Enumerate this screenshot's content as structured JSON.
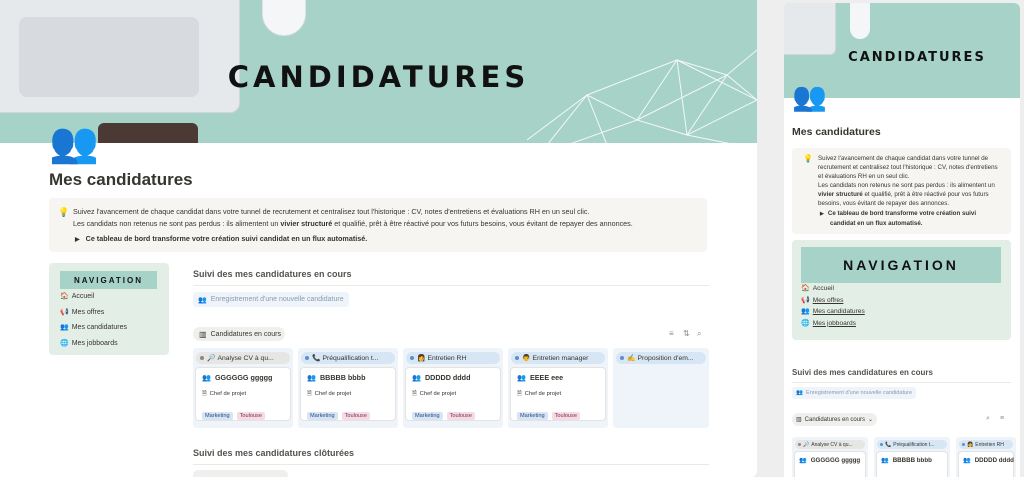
{
  "cover": {
    "title": "CANDIDATURES"
  },
  "page": {
    "icon": "people-icon",
    "title": "Mes candidatures"
  },
  "callout": {
    "icon": "lightbulb-icon",
    "line1": "Suivez l'avancement de chaque candidat dans votre tunnel de recrutement et centralisez tout l'historique : CV, notes d'entretiens et évaluations RH en un seul clic.",
    "line2_pre": "Les candidats non retenus ne sont pas perdus : ils alimentent un ",
    "line2_bold": "vivier structuré",
    "line2_post": " et qualifié, prêt à être réactivé pour vos futurs besoins, vous évitant de repayer des annonces.",
    "toggle": "Ce tableau de bord transforme votre création suivi candidat en un flux automatisé."
  },
  "navigation": {
    "title": "NAVIGATION",
    "items": [
      {
        "icon": "home-icon",
        "label": "Accueil"
      },
      {
        "icon": "megaphone-icon",
        "label": "Mes offres"
      },
      {
        "icon": "people-icon",
        "label": "Mes candidatures"
      },
      {
        "icon": "globe-icon",
        "label": "Mes jobboards"
      }
    ]
  },
  "open_section": {
    "title": "Suivi des mes candidatures en cours",
    "new_button": "Enregistrement d'une nouvelle candidature",
    "view_tab": "Candidatures en cours",
    "columns": [
      {
        "status": "Analyse CV à qu...",
        "status_icon": "magnifier-icon",
        "gray": true,
        "card": {
          "name": "GGGGGG ggggg",
          "job": "Chef de projet",
          "tags": [
            "Marketing",
            "Toulouse"
          ]
        }
      },
      {
        "status": "Préqualification t...",
        "status_icon": "phone-icon",
        "gray": false,
        "card": {
          "name": "BBBBB bbbb",
          "job": "Chef de projet",
          "tags": [
            "Marketing",
            "Toulouse"
          ]
        }
      },
      {
        "status": "Entretien RH",
        "status_icon": "person-icon",
        "gray": false,
        "card": {
          "name": "DDDDD dddd",
          "job": "Chef de projet",
          "tags": [
            "Marketing",
            "Toulouse"
          ]
        }
      },
      {
        "status": "Entretien manager",
        "status_icon": "manager-icon",
        "gray": false,
        "card": {
          "name": "EEEE eee",
          "job": "Chef de projet",
          "tags": [
            "Marketing",
            "Toulouse"
          ]
        }
      },
      {
        "status": "Proposition d'em...",
        "status_icon": "writing-icon",
        "gray": false
      }
    ]
  },
  "closed_section": {
    "title": "Suivi des mes candidatures clôturées"
  },
  "mobile": {
    "callout": {
      "l1": "Suivez l'avancement de chaque candidat dans votre tunnel de recrutement et centralisez tout l'historique : CV, notes d'entretiens et évaluations RH en un seul clic.",
      "l2_pre": "Les candidats non retenus ne sont pas perdus : ils alimentent un ",
      "l2_bold": "vivier structuré",
      "l2_post": " et qualifié, prêt à être réactivé pour vos futurs besoins, vous évitant de repayer des annonces.",
      "toggle": "Ce tableau de bord transforme votre création suivi candidat en un flux automatisé."
    },
    "columns": [
      {
        "status": "Analyse CV à qu...",
        "gray": true,
        "name": "GGGGGG ggggg"
      },
      {
        "status": "Préqualification t...",
        "gray": false,
        "name": "BBBBB bbbb"
      },
      {
        "status": "Entretien RH",
        "gray": false,
        "name": "DDDDD dddd"
      }
    ]
  },
  "colors": {
    "cover": "#a7d2c7",
    "nav_bg": "#e3eee6",
    "callout_bg": "#f6f5f2",
    "tag_blue": "#d6e4f5",
    "tag_pink": "#f5dbe6"
  }
}
